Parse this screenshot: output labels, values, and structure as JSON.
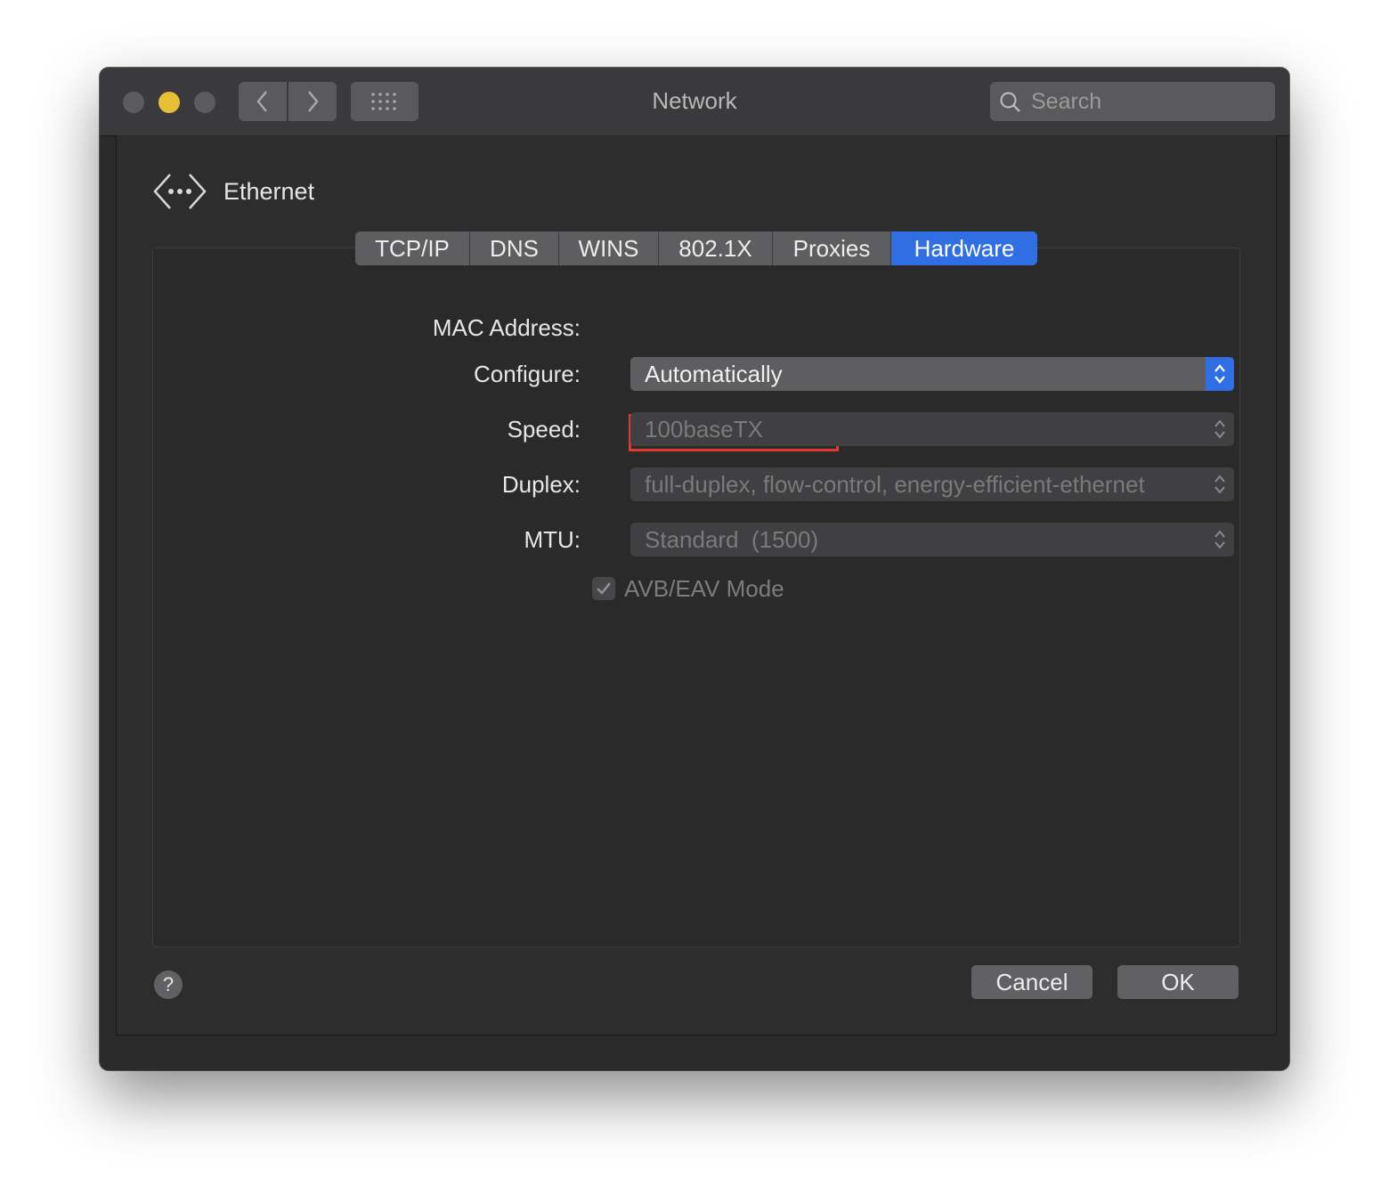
{
  "window": {
    "title": "Network"
  },
  "search": {
    "placeholder": "Search"
  },
  "interface": {
    "name": "Ethernet"
  },
  "tabs": [
    {
      "label": "TCP/IP"
    },
    {
      "label": "DNS"
    },
    {
      "label": "WINS"
    },
    {
      "label": "802.1X"
    },
    {
      "label": "Proxies"
    },
    {
      "label": "Hardware",
      "active": true
    }
  ],
  "hardware": {
    "mac_label": "MAC Address:",
    "mac_value": "",
    "configure_label": "Configure:",
    "configure_value": "Automatically",
    "speed_label": "Speed:",
    "speed_value": "100baseTX",
    "duplex_label": "Duplex:",
    "duplex_value": "full-duplex, flow-control, energy-efficient-ethernet",
    "mtu_label": "MTU:",
    "mtu_value": "Standard  (1500)",
    "avb_label": "AVB/EAV Mode",
    "avb_checked": true
  },
  "buttons": {
    "help": "?",
    "cancel": "Cancel",
    "ok": "OK"
  },
  "colors": {
    "accent": "#2f6ee3",
    "highlight": "#e03a2e",
    "minimize": "#e6bf37"
  }
}
